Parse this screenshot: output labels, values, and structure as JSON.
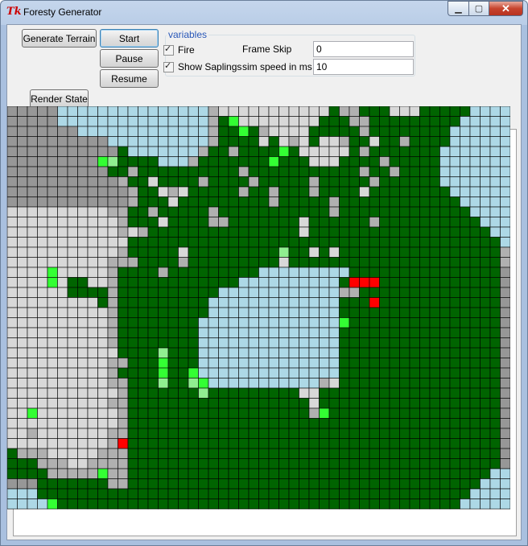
{
  "window": {
    "title": "Foresty Generator",
    "icon": "tk-feather-icon"
  },
  "buttons": {
    "generate": "Generate Terrain",
    "start": "Start",
    "pause": "Pause",
    "resume": "Resume",
    "render": "Render State"
  },
  "variables": {
    "group_label": "variables",
    "fire_label": "Fire",
    "fire_checked": true,
    "saplings_label": "Show Saplings",
    "saplings_checked": true,
    "frame_skip_label": "Frame Skip",
    "frame_skip_value": "0",
    "sim_speed_label": "sim speed in ms",
    "sim_speed_value": "10"
  },
  "grid": {
    "cols": 50,
    "rows": 40,
    "legend": {
      "D": "dark-gray",
      "M": "mid-gray",
      "L": "light-gray",
      "W": "water",
      "T": "tree",
      "S": "sapling",
      "F": "fire",
      "P": "pale-sapling"
    },
    "colors": {
      "D": "#979797",
      "M": "#b0b0b0",
      "L": "#d8d8d8",
      "W": "#add8e6",
      "T": "#006400",
      "S": "#33ff33",
      "F": "#ff0000",
      "P": "#90ee90"
    },
    "cells": [
      "DDDDDWWWWWWWWWWWWWWWMLLLLLLLLLLLTMMTTTLLLTTTTTWWWW",
      "DDDDDWWWWWWWWWWWWWWWMTSLLLLLLLLTTTMMTTTTTTTTTWWWWW",
      "DDDDDDDWWWWWWWWWWWWWMTTSTMLLLLTTTTTMTTTTTTTTWWWWWW",
      "DDDDDDDDDDWWWWWWWWWWMTTTTLTLMLTLLMTTLTTMTTTTWWWWWW",
      "DDDDDDDDDDDTWWWWWWWMTTMTTTTSTLLLLLTMTTTTTTTWWWWWWW",
      "DDDDDDDDDSPTTTTWWWMTTTTTTTSTTTLLLTTTTMTTTTTWWWWWWW",
      "DDDDDDDDDDTTMTTTTTTTTTTMTTTTTTTTTTTMTTMTTTTWWWWWWW",
      "DDDDDDDDDDDMTTLTTTTMTTTTMTTTTTMTTTTTMTTTTTTWWWWWWW",
      "DDDDDDDDDDDDMTTLMLTTTTTMTTMTTTMTTTTLTTTTTTTTWWWWWW",
      "DDDDDDDDDDDDMTTTLTTTTTTTTTMTTTTTMTTTTTTTTTTTTWWWWW",
      "LLLLLLLLLLMMTTMTTTTTMTTTTTTTTTTTMTTTTTTTTTTTTTWWWW",
      "LLLLLLLLLLLMTTTLTTTTMMTTTTTTTLTTTTTTMTTTTTTTTTTWWW",
      "LLLLLLLLLLLMLMTTTTTTTTTTTTTTTLTTTTTTTTTTTTTTTTTTWW",
      "LLLLLLLLLLLLTTTTTTTTTTTTTTTTTTTTTTTTTTTTTTTTTTTTTW",
      "LLLLLLLLLLLMTTTTTLTTTTTTTTTPTTLTLTTTTTTTTTTTTTTTTM",
      "LLLLLLLLLLMMMTTTTMTTTTTTTTTLTTTTTTTTTTTTTTTTTTTTTM",
      "LLLLSLLLLLMTTTTMTTTTTTTTTWWWWWWWWWTTTTTTTTTTTTTTTD",
      "LLLLSLTTLLMTTTTTTTTTTTTWWWWWWWWWWTFFFTTTTTTTTTTTTD",
      "LLLLLLTTTTMTTTTTTTTTTWWWWWWWWWWWWMMTTTTTTTTTTTTTTD",
      "LLLLLLLLLTMTTTTTTTTTWWWWWWWWWWWWWTTTFTTTTTTTTTTTTD",
      "LLLLLLLLLLMTTTTTTTTTWWWWWWWWWWWWWTTTTTTTTTTTTTTTTD",
      "LLLLLLLLLLMTTTTTTTTWWWWWWWWWWWWWWSTTTTTTTTTTTTTTTD",
      "LLLLLLLLLLMTTTTTTTTWWWWWWWWWWWWWWTTTTTTTTTTTTTTTTD",
      "LLLLLLLLLLMTTTTTTTTWWWWWWWWWWWWWWTTTTTTTTTTTTTTTTD",
      "LLLLLLLLLLLTTTTPTTTWWWWWWWWWWWWWWTTTTTTTTTTTTTTTTD",
      "LLLLLLLLLLMMTTTSTTTWWWWWWWWWWWWWWTTTTTTTTTTTTTTTTD",
      "LLLLLLLLLLMTTTTSTTSWWWWWWWWWWWWWWTTTTTTTTTTTTTTTTD",
      "LLLLLLLLLLMMTTTPTTPSWWWWWWWWWWWMLTTTTTTTTTTTTTTTTD",
      "LLLLLLLLLLLMTTTTTTTPTTTTTTTTTLLTTTTTTTTTTTTTTTTTTD",
      "LLLLLLLLLLMMTTTTTTTTTTTTTTTTTTLTTTTTTTTTTTTTTTTTTD",
      "LLSLLLLLLLLMTTTTTTTTTTTTTTTTTTMSTTTTTTTTTTTTTTTTTD",
      "LLLLLLLLLLLMTTTTTTTTTTTTTTTTTTTTTTTTTTTTTTTTTTTTTD",
      "LLMLLLLLLLMMTTTTTTTTTTTTTTTTTTTTTTTTTTTTTTTTTTTTTD",
      "LLLLLLLLLLMFTTTTTTTTTTTTTTTTTTTTTTTTTTTTTTTTTTTTTD",
      "TMMMLLLLLMMMTTTTTTTTTTTTTTTTTTTTTTTTTTTTTTTTTTTTTD",
      "TTTMMMLLMMMMTTTTTTTTTTTTTTTTTTTTTTTTTTTTTTTTTTTTTD",
      "TTTTMMMMMSMMTTTTTTTTTTTTTTTTTTTTTTTTTTTTTTTTTTTTWW",
      "DDDTTTTTTTMMTTTTTTTTTTTTTTTTTTTTTTTTTTTTTTTTTTTWWW",
      "WWWTTTTTTTTTTTTTTTTTTTTTTTTTTTTTTTTTTTTTTTTTTTWWWW",
      "WWWWSTTTTTTTTTTTTTTTTTTTTTTTTTTTTTTTTTTTTTTTTWWWWW"
    ]
  }
}
